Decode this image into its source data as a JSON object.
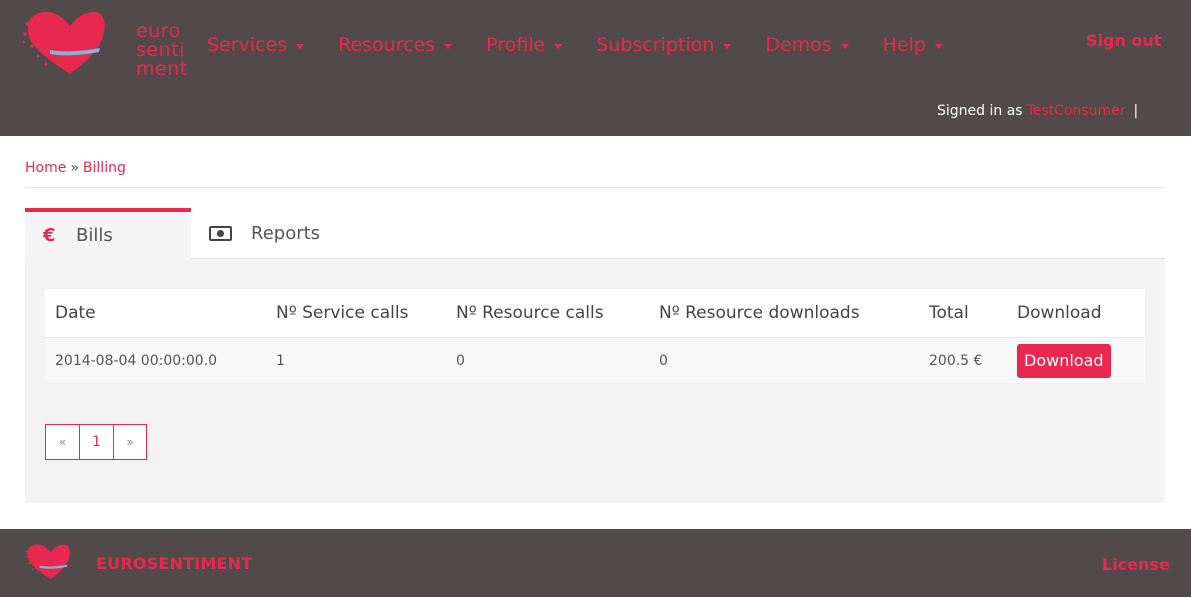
{
  "brand": {
    "logo_lines": [
      "euro",
      "senti",
      "ment"
    ],
    "name": "EUROSENTIMENT",
    "accent": "#e8284e",
    "header_bg": "#524a4a"
  },
  "nav": {
    "items": [
      {
        "label": "Services"
      },
      {
        "label": "Resources"
      },
      {
        "label": "Profile"
      },
      {
        "label": "Subscription"
      },
      {
        "label": "Demos"
      },
      {
        "label": "Help"
      }
    ],
    "sign_out": "Sign out",
    "signed_in_prefix": "Signed in as",
    "username": "TestConsumer",
    "separator": "|"
  },
  "breadcrumb": {
    "home": "Home",
    "separator": "»",
    "current": "Billing"
  },
  "tabs": [
    {
      "label": "Bills",
      "icon": "euro-icon",
      "glyph": "€",
      "active": true
    },
    {
      "label": "Reports",
      "icon": "banknote-icon",
      "active": false
    }
  ],
  "table": {
    "headers": [
      "Date",
      "Nº Service calls",
      "Nº Resource calls",
      "Nº Resource downloads",
      "Total",
      "Download"
    ],
    "rows": [
      {
        "date": "2014-08-04 00:00:00.0",
        "service_calls": "1",
        "resource_calls": "0",
        "resource_downloads": "0",
        "total": "200.5 €",
        "download_label": "Download"
      }
    ]
  },
  "pagination": {
    "prev": "«",
    "pages": [
      "1"
    ],
    "next": "»"
  },
  "footer": {
    "license": "License"
  }
}
